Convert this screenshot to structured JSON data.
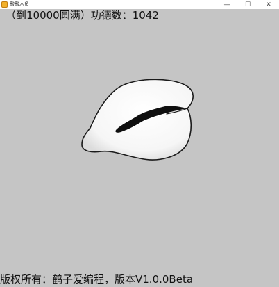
{
  "window": {
    "title": "敲敲木鱼",
    "controls": {
      "minimize": "—",
      "maximize": "☐",
      "close": "✕"
    }
  },
  "counter": {
    "text": "（到10000圆满）功德数：1042"
  },
  "footer": {
    "text": "版权所有：鹤子爱编程，版本V1.0.0Beta"
  },
  "colors": {
    "background": "#c5c5c5",
    "fish_body": "#f7f7f7",
    "fish_outline": "#1a1a1a"
  }
}
